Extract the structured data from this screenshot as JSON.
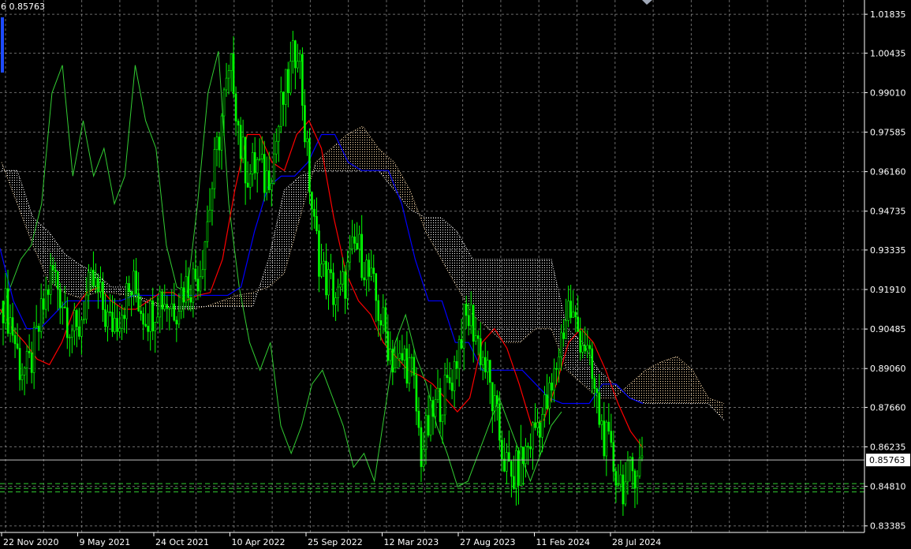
{
  "header": {
    "price_text": "6 0.85763"
  },
  "colors": {
    "background": "#000000",
    "grid": "#c0c0c0",
    "axis": "#ffffff",
    "candles": "#00ff00",
    "kijun": "#0000ff",
    "tenkan": "#ff0000",
    "chikou": "#32cd32",
    "kumo_bull": "#ffdead",
    "kumo_bear": "#ffffff",
    "current_price_line": "#c0c0c0",
    "hline": "#32cd32"
  },
  "chart_data": {
    "type": "candlestick",
    "symbol_price": 0.85763,
    "price_ticks": [
      "1.01835",
      "1.00435",
      "0.99010",
      "0.97585",
      "0.96160",
      "0.94735",
      "0.93335",
      "0.91910",
      "0.90485",
      "0.89060",
      "0.87660",
      "0.86235",
      "0.84810",
      "0.83385"
    ],
    "time_ticks": [
      "22 Nov 2020",
      "9 May 2021",
      "24 Oct 2021",
      "10 Apr 2022",
      "25 Sep 2022",
      "12 Mar 2023",
      "27 Aug 2023",
      "11 Feb 2024",
      "28 Jul 2024"
    ],
    "ylim": [
      0.8315,
      1.0235
    ],
    "current_price_label": "0.85763",
    "horizontal_levels": [
      0.8491,
      0.8474,
      0.8461
    ],
    "close_path": [
      0.915,
      0.907,
      0.892,
      0.889,
      0.9,
      0.914,
      0.926,
      0.918,
      0.908,
      0.902,
      0.915,
      0.921,
      0.914,
      0.906,
      0.91,
      0.916,
      0.92,
      0.912,
      0.91,
      0.917,
      0.915,
      0.913,
      0.92,
      0.922,
      0.926,
      0.945,
      0.967,
      0.988,
      0.999,
      0.97,
      0.96,
      0.965,
      0.958,
      0.967,
      0.985,
      0.996,
      1.01,
      0.97,
      0.94,
      0.925,
      0.92,
      0.915,
      0.925,
      0.935,
      0.93,
      0.92,
      0.91,
      0.9,
      0.89,
      0.895,
      0.888,
      0.86,
      0.87,
      0.878,
      0.882,
      0.89,
      0.905,
      0.91,
      0.9,
      0.89,
      0.875,
      0.86,
      0.85,
      0.855,
      0.862,
      0.87,
      0.875,
      0.882,
      0.9,
      0.913,
      0.905,
      0.9,
      0.885,
      0.87,
      0.86,
      0.852,
      0.848,
      0.855,
      0.857
    ],
    "kijun_path": [
      0.934,
      0.915,
      0.905,
      0.905,
      0.91,
      0.915,
      0.915,
      0.915,
      0.915,
      0.915,
      0.917,
      0.917,
      0.917,
      0.917,
      0.917,
      0.917,
      0.917,
      0.917,
      0.92,
      0.94,
      0.956,
      0.96,
      0.96,
      0.965,
      0.975,
      0.975,
      0.965,
      0.962,
      0.962,
      0.962,
      0.95,
      0.93,
      0.915,
      0.915,
      0.9,
      0.9,
      0.89,
      0.89,
      0.89,
      0.89,
      0.885,
      0.88,
      0.878,
      0.878,
      0.878,
      0.885,
      0.885,
      0.88,
      0.878
    ],
    "tenkan_path": [
      0.912,
      0.905,
      0.9,
      0.894,
      0.892,
      0.9,
      0.912,
      0.918,
      0.92,
      0.915,
      0.912,
      0.912,
      0.915,
      0.918,
      0.918,
      0.915,
      0.917,
      0.918,
      0.93,
      0.955,
      0.975,
      0.975,
      0.965,
      0.962,
      0.975,
      0.98,
      0.97,
      0.945,
      0.925,
      0.915,
      0.91,
      0.9,
      0.895,
      0.89,
      0.888,
      0.885,
      0.88,
      0.875,
      0.88,
      0.9,
      0.905,
      0.898,
      0.885,
      0.87,
      0.872,
      0.885,
      0.9,
      0.905,
      0.9,
      0.89,
      0.878,
      0.868,
      0.862
    ],
    "chikou_path": [
      0.91,
      0.92,
      0.93,
      0.935,
      0.95,
      0.99,
      1.0,
      0.96,
      0.98,
      0.96,
      0.97,
      0.95,
      0.96,
      1.0,
      0.98,
      0.97,
      0.935,
      0.92,
      0.918,
      0.95,
      0.99,
      1.005,
      0.95,
      0.92,
      0.9,
      0.89,
      0.9,
      0.87,
      0.86,
      0.87,
      0.885,
      0.89,
      0.88,
      0.87,
      0.855,
      0.86,
      0.85,
      0.875,
      0.9,
      0.91,
      0.895,
      0.885,
      0.87,
      0.86,
      0.848,
      0.85,
      0.86,
      0.87,
      0.88,
      0.87,
      0.86,
      0.85,
      0.86,
      0.87,
      0.875
    ],
    "span_a_path": [
      0.965,
      0.95,
      0.935,
      0.922,
      0.918,
      0.916,
      0.918,
      0.918,
      0.917,
      0.916,
      0.914,
      0.912,
      0.912,
      0.913,
      0.915,
      0.917,
      0.918,
      0.92,
      0.925,
      0.945,
      0.965,
      0.97,
      0.975,
      0.978,
      0.97,
      0.965,
      0.955,
      0.94,
      0.93,
      0.92,
      0.91,
      0.905,
      0.9,
      0.9,
      0.905,
      0.905,
      0.89,
      0.885,
      0.88,
      0.88,
      0.885,
      0.89,
      0.893,
      0.895,
      0.89,
      0.88,
      0.878
    ],
    "span_b_path": [
      0.962,
      0.962,
      0.945,
      0.94,
      0.932,
      0.928,
      0.925,
      0.92,
      0.92,
      0.915,
      0.913,
      0.913,
      0.913,
      0.913,
      0.913,
      0.913,
      0.913,
      0.93,
      0.955,
      0.96,
      0.962,
      0.962,
      0.962,
      0.962,
      0.962,
      0.955,
      0.948,
      0.945,
      0.945,
      0.94,
      0.93,
      0.93,
      0.93,
      0.93,
      0.93,
      0.93,
      0.905,
      0.9,
      0.89,
      0.885,
      0.88,
      0.878,
      0.878,
      0.878,
      0.878,
      0.878,
      0.872
    ]
  }
}
